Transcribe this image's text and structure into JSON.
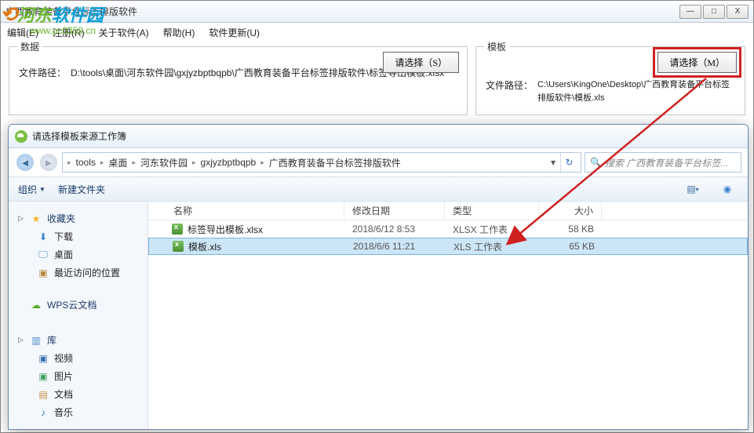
{
  "main": {
    "title": "广西教育装备平台标签排版软件",
    "win_min": "—",
    "win_max": "□",
    "win_close": "X"
  },
  "menu": {
    "edit": "编辑(E)",
    "register": "注册(R)",
    "about": "关于软件(A)",
    "help": "帮助(H)",
    "update": "软件更新(U)"
  },
  "data_group": {
    "title": "数据",
    "select_btn": "请选择（S）",
    "path_label": "文件路径：",
    "path_value": "D:\\tools\\桌面\\河东软件园\\gxjyzbptbqpb\\广西教育装备平台标签排版软件\\标签导出模板.xlsx"
  },
  "tpl_group": {
    "title": "模板",
    "select_btn": "请选择（M）",
    "path_label": "文件路径：",
    "path_value": "C:\\Users\\KingOne\\Desktop\\广西教育装备平台标签排版软件\\模板.xls"
  },
  "watermark": {
    "text_a": "河东",
    "text_b": "软件园",
    "url": "www.pc0359.cn"
  },
  "dialog": {
    "title": "请选择模板来源工作簿",
    "crumbs": [
      "tools",
      "桌面",
      "河东软件园",
      "gxjyzbptbqpb",
      "广西教育装备平台标签排版软件"
    ],
    "search_placeholder": "搜索 广西教育装备平台标签...",
    "organize": "组织",
    "new_folder": "新建文件夹"
  },
  "sidebar": {
    "fav": "收藏夹",
    "downloads": "下载",
    "desktop": "桌面",
    "recent": "最近访问的位置",
    "wps": "WPS云文档",
    "library": "库",
    "video": "视频",
    "pictures": "图片",
    "docs": "文档",
    "music": "音乐"
  },
  "columns": {
    "name": "名称",
    "date": "修改日期",
    "type": "类型",
    "size": "大小"
  },
  "files": [
    {
      "name": "标签导出模板.xlsx",
      "date": "2018/6/12 8:53",
      "type": "XLSX 工作表",
      "size": "58 KB",
      "selected": false
    },
    {
      "name": "模板.xls",
      "date": "2018/6/6 11:21",
      "type": "XLS 工作表",
      "size": "65 KB",
      "selected": true
    }
  ]
}
